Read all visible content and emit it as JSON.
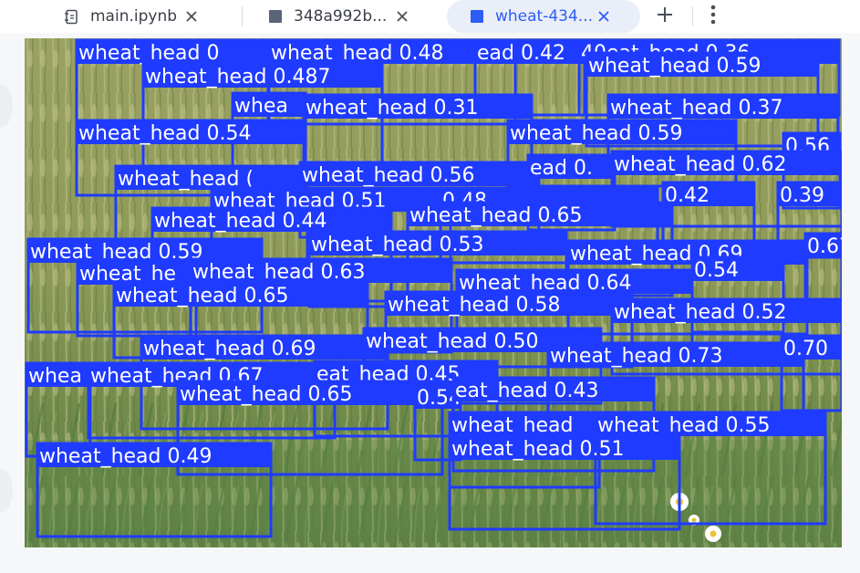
{
  "tabs": [
    {
      "label": "main.ipynb",
      "icon": "notebook-icon",
      "active": false
    },
    {
      "label": "348a992b...",
      "icon": "image-file-icon",
      "active": false
    },
    {
      "label": "wheat-434...",
      "icon": "image-file-icon",
      "active": true
    }
  ],
  "toolbar": {
    "new_tab_icon": "plus-icon",
    "more_icon": "more-vertical-icon"
  },
  "colors": {
    "accent": "#2d5cf6",
    "box": "#1f3bff",
    "label_bg": "#1f3bff",
    "label_text": "#ffffff"
  },
  "detections": [
    {
      "label": "wheat_head 0",
      "score": ""
    },
    {
      "label": "wheat_head 0.48",
      "score": ""
    },
    {
      "label": "ead 0.42",
      "score": ""
    },
    {
      "label": "40eat_head 0.36",
      "score": ""
    },
    {
      "label": "wheat_head 0.487",
      "score": ""
    },
    {
      "label": "wheat_head 0.59",
      "score": ""
    },
    {
      "label": "whea",
      "score": ""
    },
    {
      "label": "wheat_head 0.31",
      "score": ""
    },
    {
      "label": "wheat_head 0.37",
      "score": ""
    },
    {
      "label": "wheat_head 0.54",
      "score": ""
    },
    {
      "label": "wheat_head 0.59",
      "score": ""
    },
    {
      "label": "0.56",
      "score": ""
    },
    {
      "label": "wheat_head (",
      "score": ""
    },
    {
      "label": "wheat_head 0.56",
      "score": ""
    },
    {
      "label": "ead 0.",
      "score": ""
    },
    {
      "label": "wheat_head 0.62",
      "score": ""
    },
    {
      "label": "wheat_head 0.51",
      "score": ""
    },
    {
      "label": "0.48",
      "score": ""
    },
    {
      "label": "0.42",
      "score": ""
    },
    {
      "label": "0.39",
      "score": ""
    },
    {
      "label": "wheat_head 0.44",
      "score": ""
    },
    {
      "label": "wheat_head 0.65",
      "score": ""
    },
    {
      "label": "wheat_head 0.59",
      "score": ""
    },
    {
      "label": "wheat_head 0.53",
      "score": ""
    },
    {
      "label": "wheat_head 0.69",
      "score": ""
    },
    {
      "label": "0.67",
      "score": ""
    },
    {
      "label": "wheat_he",
      "score": ""
    },
    {
      "label": "wheat_head 0.63",
      "score": ""
    },
    {
      "label": "wheat_head 0.64",
      "score": ""
    },
    {
      "label": "0.54",
      "score": ""
    },
    {
      "label": "wheat_head 0.65",
      "score": ""
    },
    {
      "label": "wheat_head 0.58",
      "score": ""
    },
    {
      "label": "wheat_head 0.52",
      "score": ""
    },
    {
      "label": "wheat_head 0.69",
      "score": ""
    },
    {
      "label": "wheat_head 0.50",
      "score": ""
    },
    {
      "label": "wheat_head 0.73",
      "score": ""
    },
    {
      "label": "0.70",
      "score": ""
    },
    {
      "label": "whea",
      "score": ""
    },
    {
      "label": "wheat_head 0.67",
      "score": ""
    },
    {
      "label": "eat_head 0.45",
      "score": ""
    },
    {
      "label": "wheat_head 0.65",
      "score": ""
    },
    {
      "label": "0.54",
      "score": ""
    },
    {
      "label": "eat_head 0.43",
      "score": ""
    },
    {
      "label": "wheat_head",
      "score": ""
    },
    {
      "label": "wheat_head 0.55",
      "score": ""
    },
    {
      "label": "wheat_head 0.51",
      "score": ""
    },
    {
      "label": "wheat_head 0.49",
      "score": ""
    }
  ]
}
